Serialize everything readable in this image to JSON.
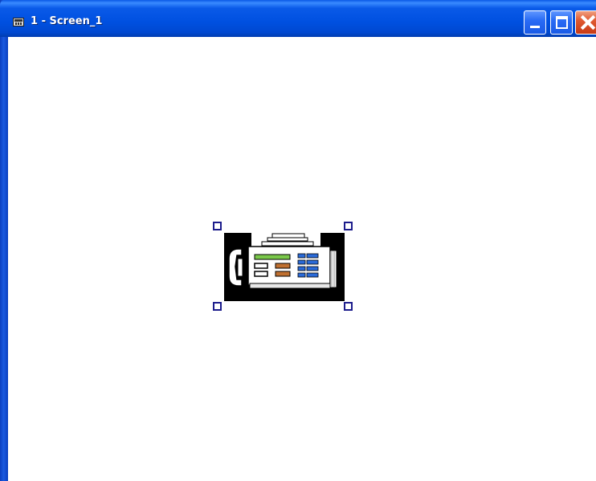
{
  "window": {
    "title": "1 - Screen_1",
    "controls": {
      "minimize": "minimize-icon",
      "maximize": "maximize-icon",
      "close": "close-icon"
    }
  },
  "canvas": {
    "selected_object": {
      "icon": "fax-machine-icon",
      "selected": true
    }
  },
  "colors": {
    "titlebar": "#0050e0",
    "close_button": "#e05a32",
    "selection_handle": "#1c1c8c"
  }
}
